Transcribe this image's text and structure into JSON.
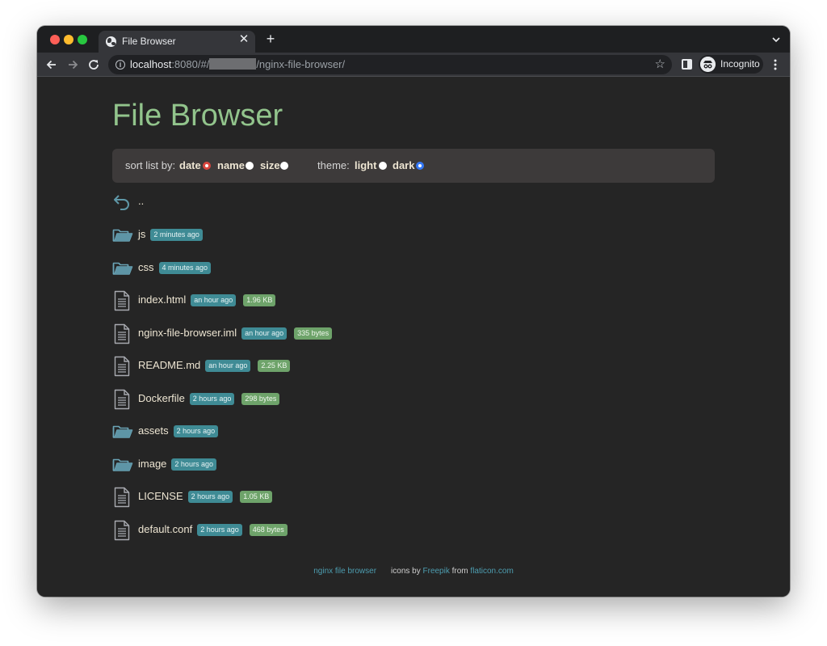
{
  "browser": {
    "tab": {
      "title": "File Browser",
      "close": "✕"
    },
    "new_tab": "+",
    "url": {
      "host": "localhost",
      "rest_before": ":8080/#/",
      "rest_after": "/nginx-file-browser/"
    },
    "profile": "Incognito"
  },
  "page": {
    "title": "File Browser",
    "controls": {
      "sort_label": "sort list by:",
      "sort_options": [
        "date",
        "name",
        "size"
      ],
      "sort_selected": "date",
      "theme_label": "theme:",
      "theme_options": [
        "light",
        "dark"
      ],
      "theme_selected": "dark"
    },
    "parent": {
      "label": ".."
    },
    "entries": [
      {
        "type": "folder",
        "name": "js",
        "time": "2 minutes ago"
      },
      {
        "type": "folder",
        "name": "css",
        "time": "4 minutes ago"
      },
      {
        "type": "file",
        "name": "index.html",
        "time": "an hour ago",
        "size": "1.96 KB"
      },
      {
        "type": "file",
        "name": "nginx-file-browser.iml",
        "time": "an hour ago",
        "size": "335 bytes"
      },
      {
        "type": "file",
        "name": "README.md",
        "time": "an hour ago",
        "size": "2.25 KB"
      },
      {
        "type": "file",
        "name": "Dockerfile",
        "time": "2 hours ago",
        "size": "298 bytes"
      },
      {
        "type": "folder",
        "name": "assets",
        "time": "2 hours ago"
      },
      {
        "type": "folder",
        "name": "image",
        "time": "2 hours ago"
      },
      {
        "type": "file",
        "name": "LICENSE",
        "time": "2 hours ago",
        "size": "1.05 KB"
      },
      {
        "type": "file",
        "name": "default.conf",
        "time": "2 hours ago",
        "size": "468 bytes"
      }
    ],
    "footer": {
      "app_link": "nginx file browser",
      "icons_by": "icons by",
      "freepik_link": "Freepik",
      "from": "from",
      "flaticon_link": "flaticon.com"
    }
  },
  "colors": {
    "title": "#92c48c",
    "time_badge": "#3f8b95",
    "size_badge": "#6ea36a",
    "link": "#4d9db0",
    "page_bg": "#252525",
    "controls_bg": "#3d3a3a"
  }
}
